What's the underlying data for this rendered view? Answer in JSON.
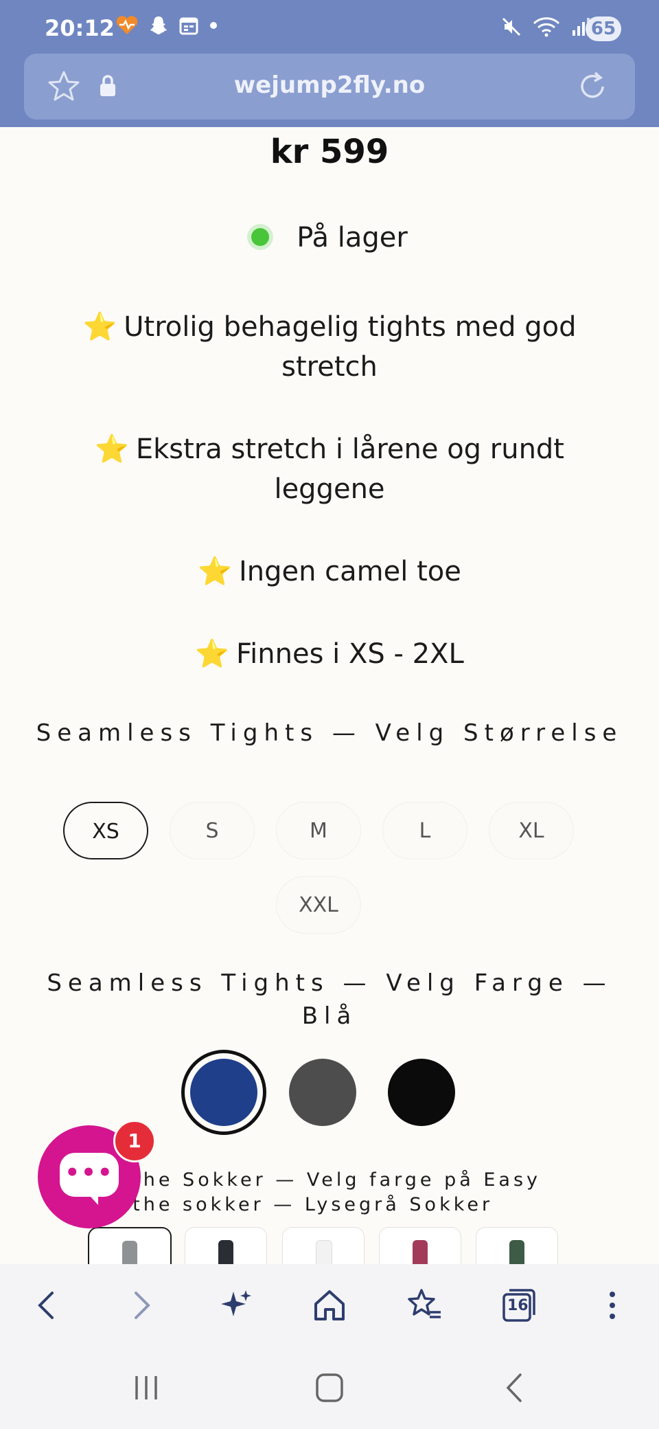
{
  "status_bar": {
    "time": "20:12",
    "battery": "65",
    "icons_left": [
      "health-icon",
      "snapchat-icon",
      "calendar-icon",
      "dot-icon"
    ],
    "icons_right": [
      "mute-icon",
      "wifi-icon",
      "signal-icon"
    ]
  },
  "browser": {
    "url": "wejump2fly.no",
    "tab_count": "16"
  },
  "product": {
    "price": "kr 599",
    "stock": "På lager",
    "features": [
      "Utrolig behagelig tights med god stretch",
      "Ekstra stretch i lårene og rundt leggene",
      "Ingen camel toe",
      "Finnes i XS - 2XL"
    ],
    "feature_emoji": "⭐"
  },
  "size_option": {
    "title": "Seamless Tights — Velg Størrelse",
    "sizes": [
      "XS",
      "S",
      "M",
      "L",
      "XL",
      "XXL"
    ],
    "selected": "XS"
  },
  "color_option": {
    "title": "Seamless Tights — Velg Farge — Blå",
    "swatches": [
      {
        "name": "Blå",
        "color": "#1f3f8a",
        "selected": true
      },
      {
        "name": "Grå",
        "color": "#4d4d4d",
        "selected": false
      },
      {
        "name": "Svart",
        "color": "#0b0b0b",
        "selected": false
      }
    ]
  },
  "socks_option": {
    "title_line1": "eathe Sokker — Velg farge på Easy",
    "title_line2": "eathe sokker — Lysegrå Sokker",
    "thumbnails": [
      {
        "name": "Lysegrå",
        "color": "#8e9292",
        "selected": true
      },
      {
        "name": "Svart",
        "color": "#2a2d33",
        "selected": false
      },
      {
        "name": "Hvit",
        "color": "#f2f2f2",
        "selected": false
      },
      {
        "name": "Rosa",
        "color": "#a23b5a",
        "selected": false
      },
      {
        "name": "Grønn",
        "color": "#3d5b45",
        "selected": false
      }
    ]
  },
  "chat": {
    "badge": "1",
    "dots": "•••"
  }
}
